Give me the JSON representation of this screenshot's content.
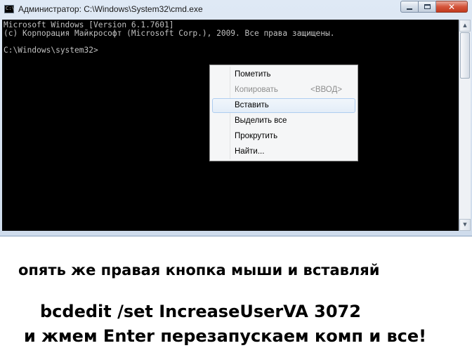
{
  "window": {
    "title": "Администратор: C:\\Windows\\System32\\cmd.exe",
    "icon": "cmd-window-icon",
    "icon_text": "C:\\",
    "buttons": {
      "minimize": "minimize-icon",
      "maximize": "maximize-icon",
      "close": "✕"
    }
  },
  "console": {
    "lines": [
      "Microsoft Windows [Version 6.1.7601]",
      "(c) Корпорация Майкрософт (Microsoft Corp.), 2009. Все права защищены.",
      "",
      "C:\\Windows\\system32>"
    ],
    "background_color": "#000000",
    "text_color": "#c0c0c0"
  },
  "scrollbar": {
    "up_arrow": "▲",
    "down_arrow": "▼"
  },
  "context_menu": {
    "items": [
      {
        "label": "Пометить",
        "shortcut": "",
        "disabled": false,
        "highlighted": false
      },
      {
        "label": "Копировать",
        "shortcut": "<ВВОД>",
        "disabled": true,
        "highlighted": false
      },
      {
        "label": "Вставить",
        "shortcut": "",
        "disabled": false,
        "highlighted": true
      },
      {
        "label": "Выделить все",
        "shortcut": "",
        "disabled": false,
        "highlighted": false
      },
      {
        "label": "Прокрутить",
        "shortcut": "",
        "disabled": false,
        "highlighted": false
      },
      {
        "label": "Найти...",
        "shortcut": "",
        "disabled": false,
        "highlighted": false
      }
    ]
  },
  "caption": {
    "line1": "опять же правая кнопка мыши и вставляй",
    "line2": "bcdedit /set IncreaseUserVA 3072",
    "line3": "и жмем Enter перезапускаем комп и все!"
  }
}
